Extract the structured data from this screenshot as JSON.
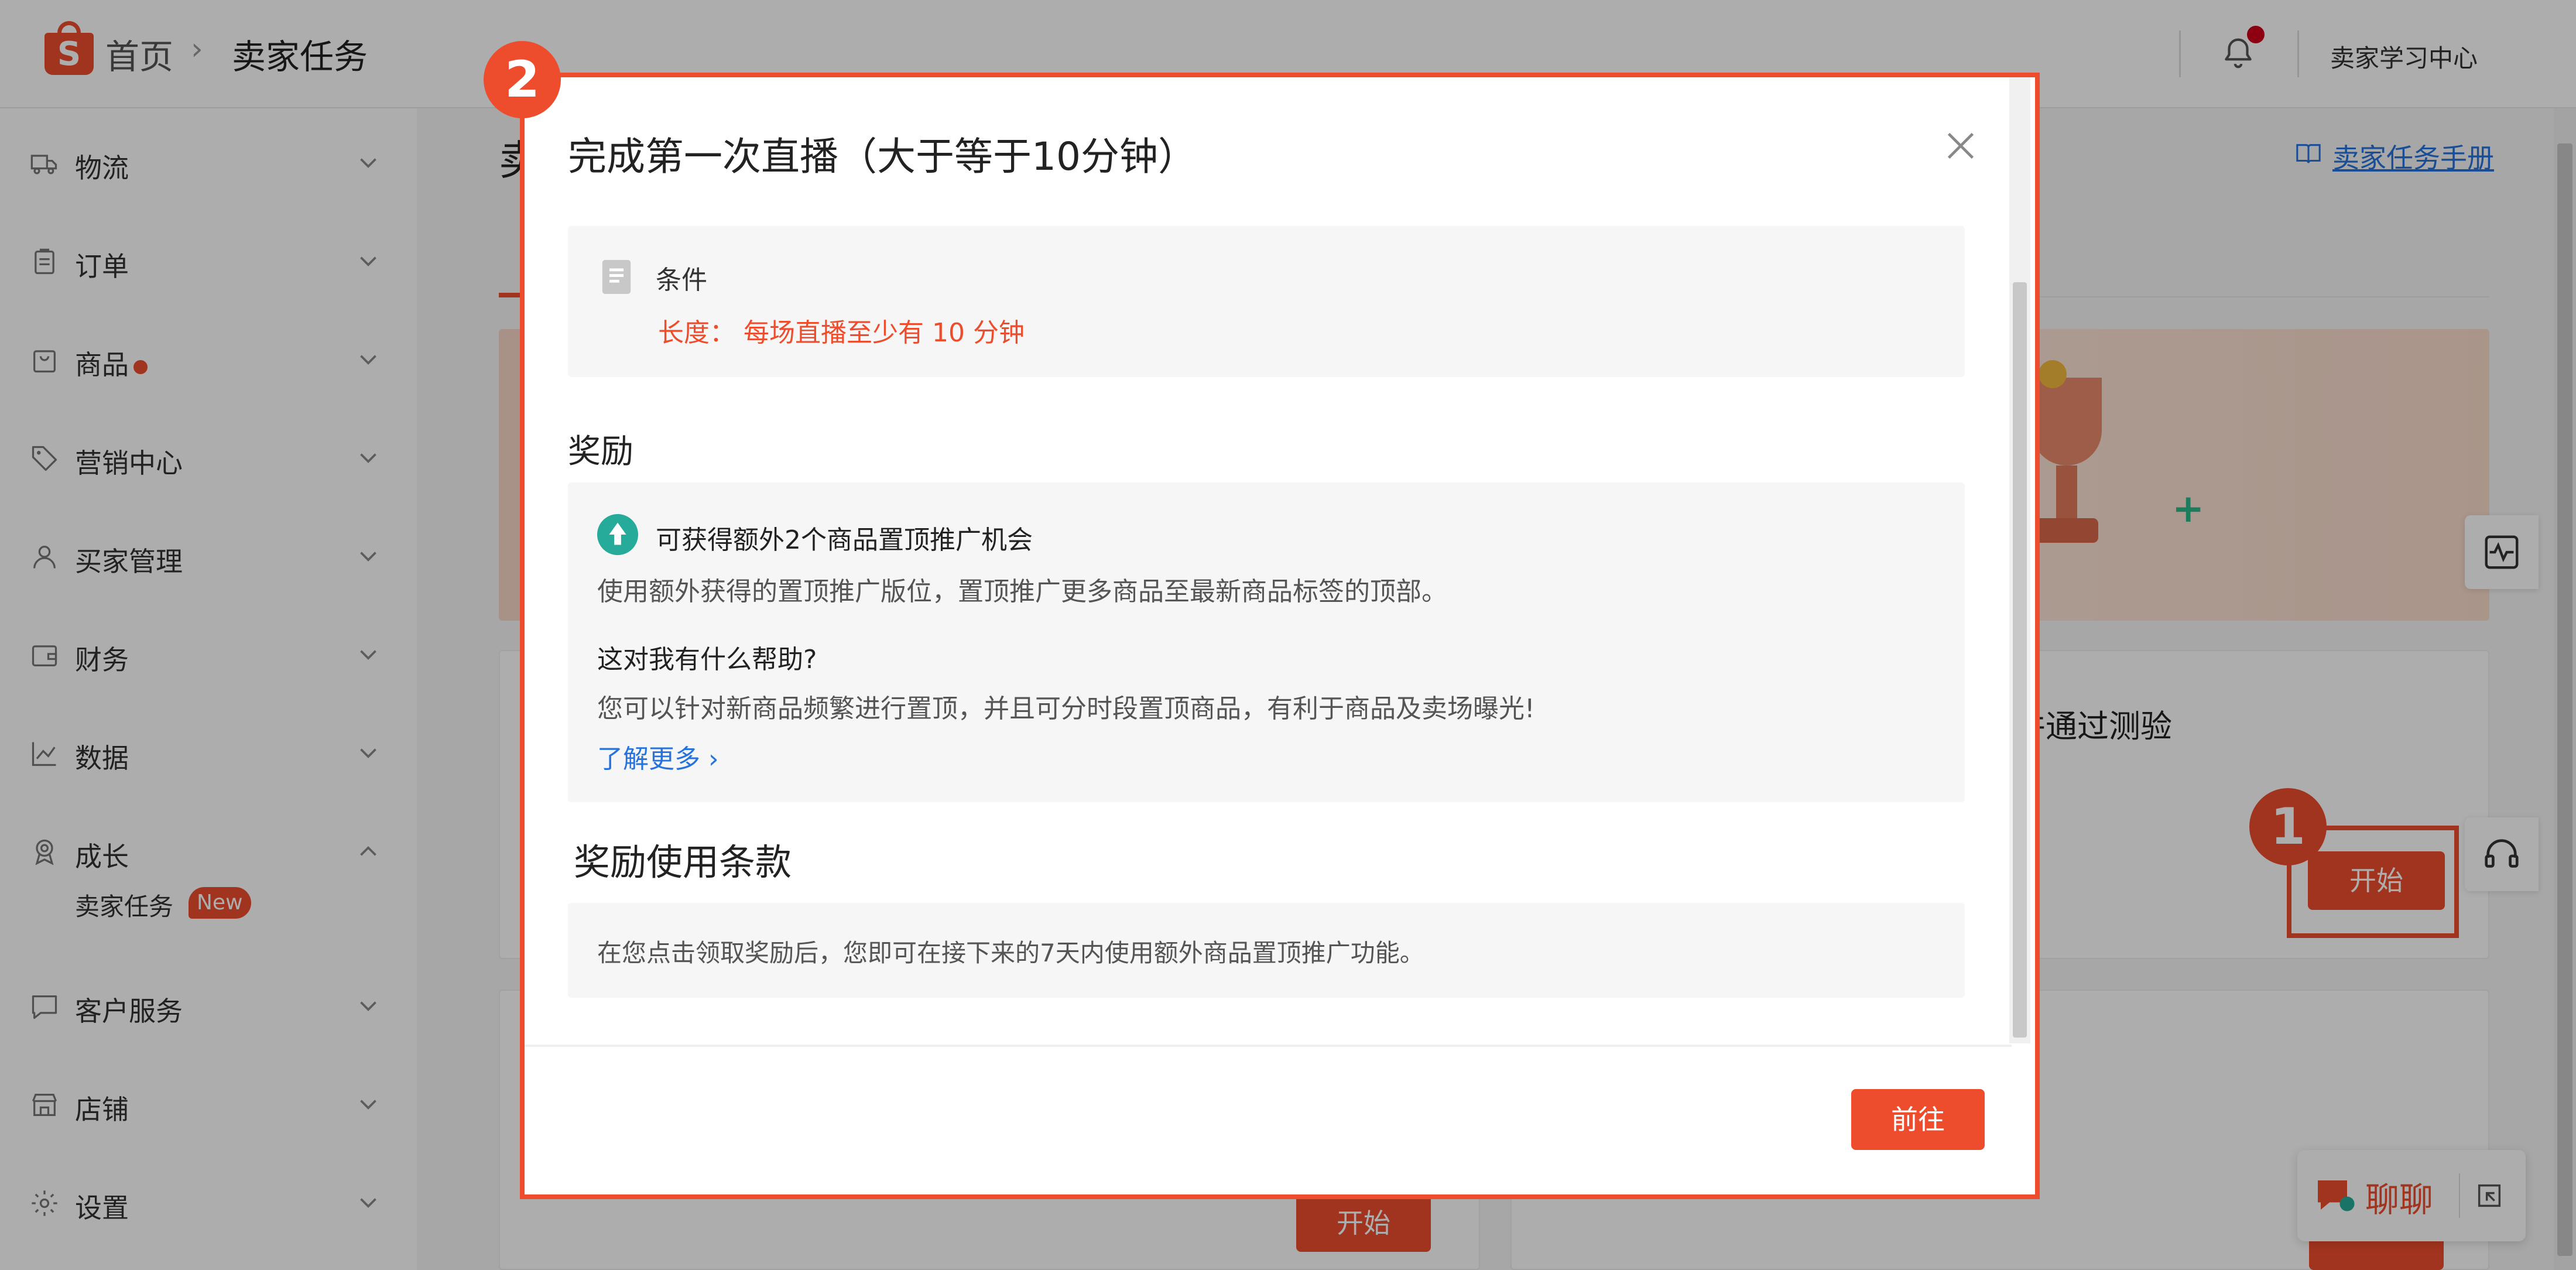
{
  "header": {
    "breadcrumb_home": "首页",
    "breadcrumb_sep": "›",
    "breadcrumb_current": "卖家任务",
    "learning_center": "卖家学习中心"
  },
  "sidebar": {
    "items": [
      {
        "label": "物流",
        "icon": "truck-icon"
      },
      {
        "label": "订单",
        "icon": "clipboard-icon"
      },
      {
        "label": "商品",
        "icon": "bag-icon"
      },
      {
        "label": "营销中心",
        "icon": "tag-icon"
      },
      {
        "label": "买家管理",
        "icon": "user-icon"
      },
      {
        "label": "财务",
        "icon": "wallet-icon"
      },
      {
        "label": "数据",
        "icon": "chart-icon"
      },
      {
        "label": "成长",
        "icon": "badge-icon"
      },
      {
        "label": "客户服务",
        "icon": "chat-icon"
      },
      {
        "label": "店铺",
        "icon": "store-icon"
      },
      {
        "label": "设置",
        "icon": "gear-icon"
      }
    ],
    "sub_item": "卖家任务",
    "new_badge": "New"
  },
  "main": {
    "title_partial": "卖",
    "manual_link": "卖家任务手册",
    "card1_text": "并通过测验",
    "start_label": "开始",
    "start_label_2": "开始"
  },
  "markers": {
    "one": "1",
    "two": "2"
  },
  "modal": {
    "title": "完成第一次直播（大于等于10分钟）",
    "condition_label": "条件",
    "condition_value": "长度：  每场直播至少有 10 分钟",
    "reward_heading": "奖励",
    "reward_title": "可获得额外2个商品置顶推广机会",
    "reward_desc": "使用额外获得的置顶推广版位，置顶推广更多商品至最新商品标签的顶部。",
    "help_question": "这对我有什么帮助?",
    "help_answer": "您可以针对新商品频繁进行置顶，并且可分时段置顶商品，有利于商品及卖场曝光!",
    "learn_more": "了解更多 ›",
    "terms_heading": "奖励使用条款",
    "terms_text": "在您点击领取奖励后，您即可在接下来的7天内使用额外商品置顶推广功能。",
    "go_button": "前往"
  },
  "chat": {
    "label": "聊聊"
  },
  "colors": {
    "brand": "#ee4d2d",
    "link": "#2673dd",
    "reward_icon": "#26aa99"
  }
}
